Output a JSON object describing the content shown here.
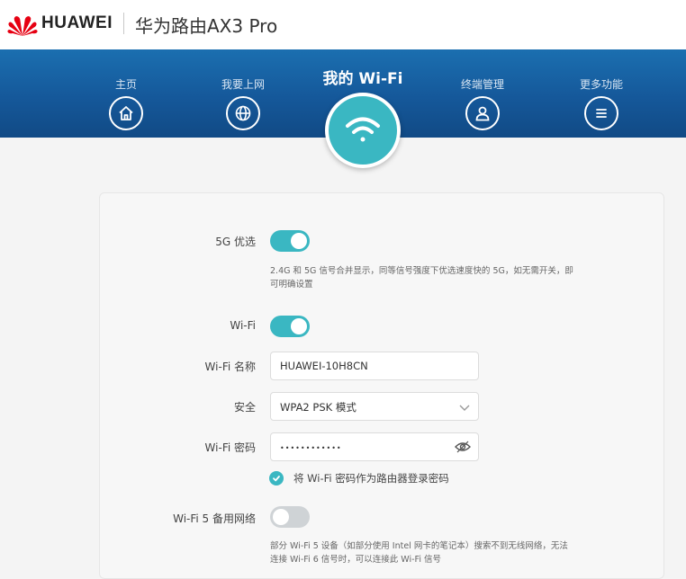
{
  "header": {
    "brand": "HUAWEI",
    "product": "华为路由AX3 Pro",
    "logo_color": "#e60012"
  },
  "nav": {
    "items": [
      {
        "label": "主页",
        "icon": "home-icon"
      },
      {
        "label": "我要上网",
        "icon": "globe-icon"
      },
      {
        "label": "终端管理",
        "icon": "user-icon"
      },
      {
        "label": "更多功能",
        "icon": "menu-icon"
      }
    ],
    "active": {
      "label": "我的 Wi-Fi",
      "icon": "wifi-icon"
    },
    "accent_color": "#3ab7c2",
    "band_color": "#15589a"
  },
  "settings": {
    "prefer5g": {
      "label": "5G 优选",
      "state": "on",
      "description": "2.4G 和 5G 信号合并显示，同等信号强度下优选速度快的 5G，如无需开关，即可明确设置"
    },
    "wifi": {
      "label": "Wi-Fi",
      "state": "on"
    },
    "wifi_name": {
      "label": "Wi-Fi 名称",
      "value": "HUAWEI-10H8CN"
    },
    "security": {
      "label": "安全",
      "value": "WPA2 PSK 模式"
    },
    "password": {
      "label": "Wi-Fi 密码",
      "value": "••••••••••••"
    },
    "use_as_admin": {
      "label": "将 Wi-Fi 密码作为路由器登录密码",
      "checked": true
    },
    "wifi5_backup": {
      "label": "Wi-Fi 5 备用网络",
      "state": "off",
      "description": "部分 Wi-Fi 5 设备（如部分使用 Intel 网卡的笔记本）搜索不到无线网络，无法连接 Wi-Fi 6 信号时，可以连接此 Wi-Fi 信号"
    }
  }
}
